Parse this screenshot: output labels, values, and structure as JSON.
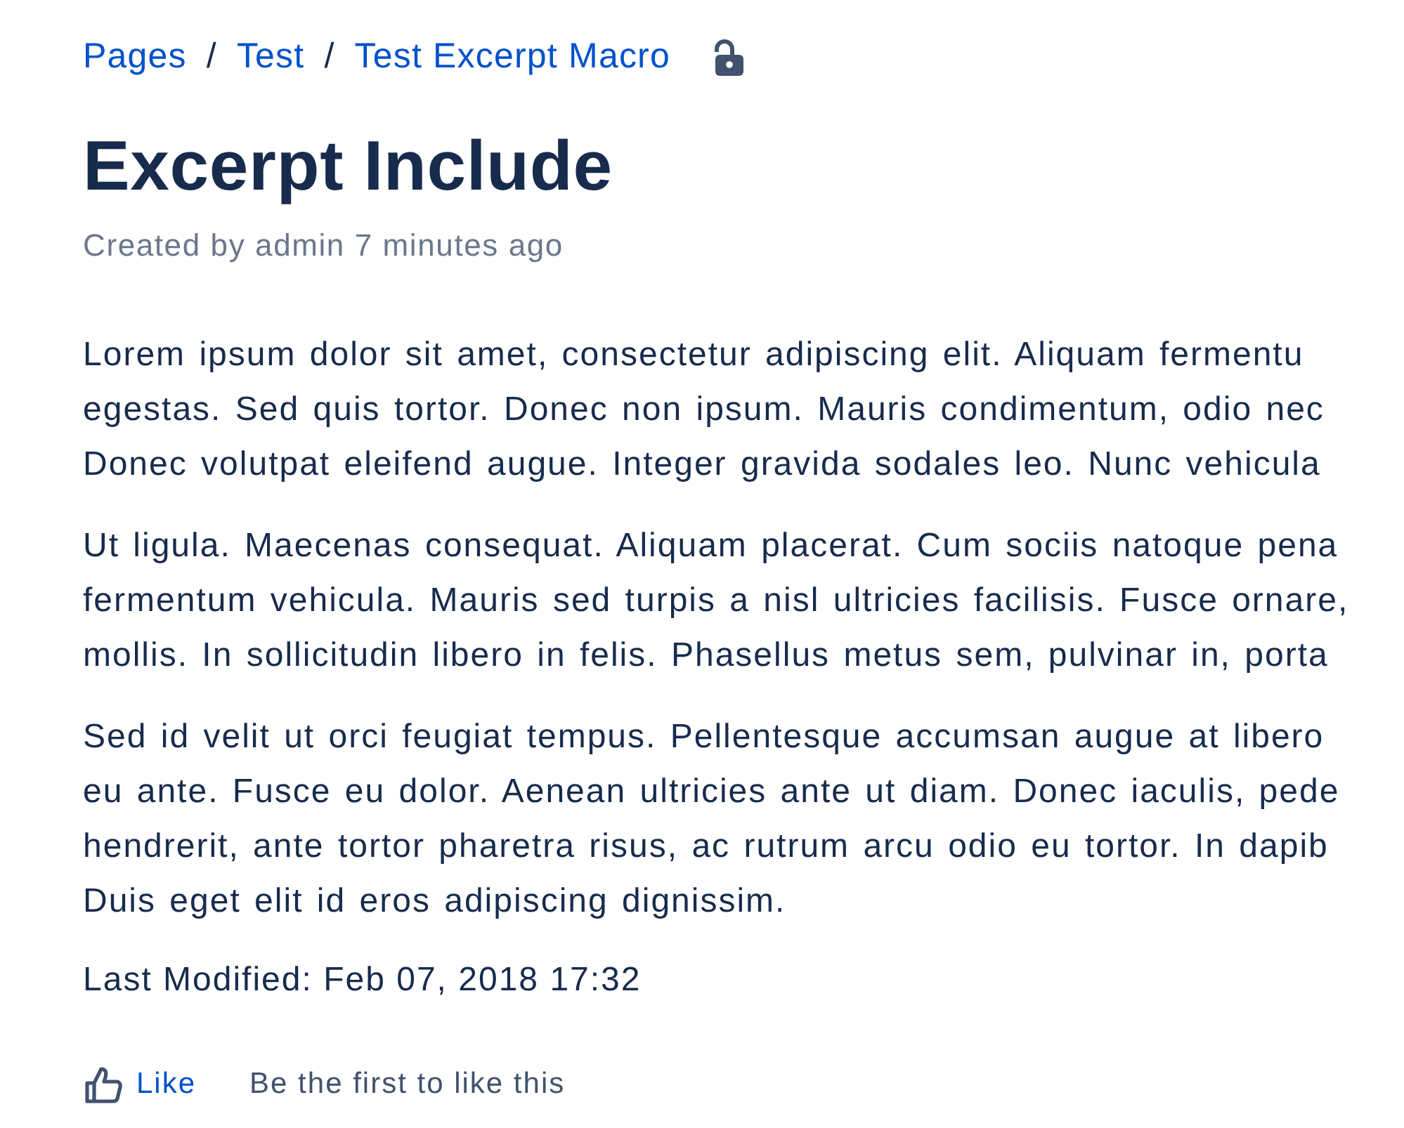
{
  "breadcrumbs": [
    "Pages",
    "Test",
    "Test Excerpt Macro"
  ],
  "breadcrumb_separators": [
    "/",
    "/"
  ],
  "restrictions": {
    "locked": false
  },
  "title": "Excerpt Include",
  "byline": "Created by admin 7 minutes ago",
  "paragraphs": [
    {
      "lines": [
        "Lorem ipsum dolor sit amet, consectetur adipiscing elit. Aliquam fermentu",
        "egestas. Sed quis tortor. Donec non ipsum. Mauris condimentum, odio nec",
        "Donec volutpat eleifend augue. Integer gravida sodales leo. Nunc vehicula"
      ]
    },
    {
      "lines": [
        "Ut ligula. Maecenas consequat. Aliquam placerat. Cum sociis natoque pena",
        "fermentum vehicula. Mauris sed turpis a nisl ultricies facilisis. Fusce ornare,",
        "mollis. In sollicitudin libero in felis. Phasellus metus sem, pulvinar in, porta"
      ]
    },
    {
      "lines": [
        "Sed id velit ut orci feugiat tempus. Pellentesque accumsan augue at libero",
        "eu ante. Fusce eu dolor. Aenean ultricies ante ut diam. Donec iaculis, pede",
        "hendrerit, ante tortor pharetra risus, ac rutrum arcu odio eu tortor. In dapib",
        "Duis eget elit id eros adipiscing dignissim."
      ]
    }
  ],
  "last_modified": "Last Modified: Feb 07, 2018 17:32",
  "like": {
    "label": "Like",
    "summary": "Be the first to like this"
  }
}
